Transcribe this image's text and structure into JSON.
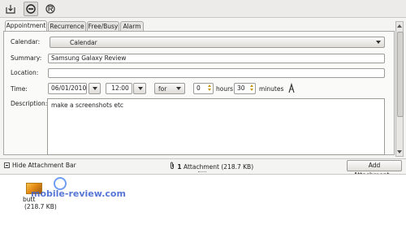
{
  "toolbar": {
    "buttons": [
      {
        "icon": "save-close-icon"
      },
      {
        "icon": "remove-icon",
        "active": true
      },
      {
        "icon": "reply-icon"
      }
    ]
  },
  "tabs": [
    "Appointment",
    "Recurrence",
    "Free/Busy",
    "Alarm"
  ],
  "form": {
    "calendar_label": "Calendar:",
    "calendar_value": "Calendar",
    "summary_label": "Summary:",
    "summary_value": "Samsung Galaxy Review",
    "location_label": "Location:",
    "location_value": "",
    "time_label": "Time:",
    "date_value": "06/01/2010",
    "time_value": "12:00",
    "duration_mode": "for",
    "hours_value": "0",
    "hours_label": "hours",
    "minutes_value": "30",
    "minutes_label": "minutes",
    "timezone_icon": "timezone-icon",
    "description_label": "Description:",
    "description_value": "make a screenshots etc"
  },
  "attachments": {
    "hide_label": "Hide Attachment Bar",
    "count": "1",
    "summary_text": " Attachment (218.7 KB)",
    "add_button": "Add Attachment...",
    "file_name": "butt",
    "file_size": "(218.7 KB)",
    "watermark": "mobile-review.com"
  },
  "colors": {
    "accent": "#c69a14",
    "watermark": "#3a5fd0"
  }
}
